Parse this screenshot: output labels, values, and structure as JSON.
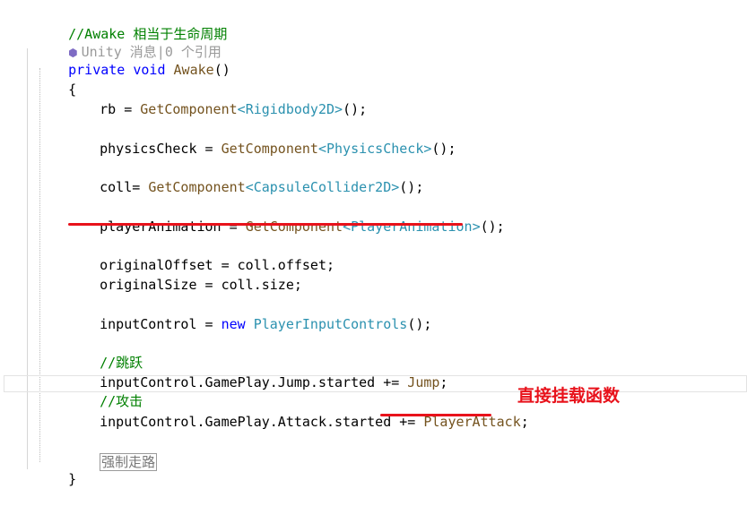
{
  "code": {
    "comment_awake": "//Awake 相当于生命周期",
    "codelens": "Unity 消息|0 个引用",
    "kw_private": "private",
    "kw_void": "void",
    "method_awake": "Awake",
    "parens_awake": "()",
    "brace_open": "{",
    "brace_close": "}",
    "rb_lhs": "rb = ",
    "get_component": "GetComponent",
    "lt": "<",
    "gt": ">",
    "call_end": "();",
    "type_rigidbody2d": "Rigidbody2D",
    "physics_lhs": "physicsCheck = ",
    "type_physicscheck": "PhysicsCheck",
    "coll_lhs": "coll= ",
    "type_capsulecollider2d": "CapsuleCollider2D",
    "playeranim_lhs": "playerAnimation = ",
    "type_playeranimation": "PlayerAnimation",
    "original_offset": "originalOffset = coll.offset;",
    "original_size": "originalSize = coll.size;",
    "input_lhs": "inputControl = ",
    "kw_new": "new",
    "type_playerinputcontrols": "PlayerInputControls",
    "comment_jump": "//跳跃",
    "jump_lhs": "inputControl.GamePlay.Jump.started += ",
    "method_jump": "Jump",
    "semicolon": ";",
    "comment_attack": "//攻击",
    "attack_lhs": "inputControl.GamePlay.Attack.started += ",
    "method_playerattack": "PlayerAttack",
    "hint_text": "强制走路"
  },
  "annotation": {
    "text": "直接挂载函数",
    "color": "#e8121b"
  },
  "colors": {
    "comment": "#008000",
    "keyword": "#0000ff",
    "method": "#74531f",
    "type": "#2b91af"
  },
  "icons": {
    "codelens_icon": "unity-cube-icon"
  }
}
